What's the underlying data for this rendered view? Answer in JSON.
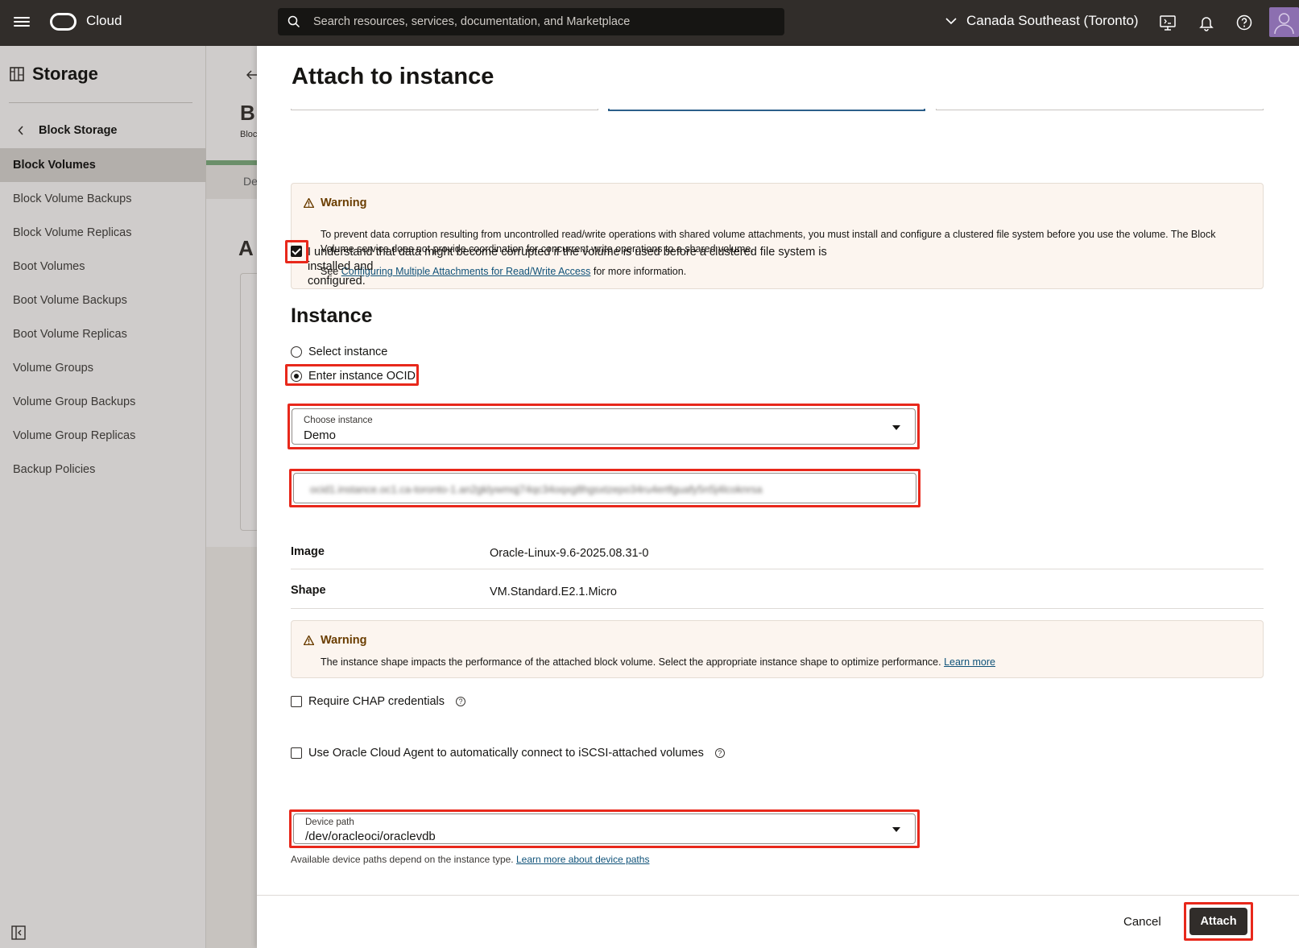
{
  "topbar": {
    "brand": "Cloud",
    "search_placeholder": "Search resources, services, documentation, and Marketplace",
    "region": "Canada Southeast (Toronto)"
  },
  "sidebar": {
    "title": "Storage",
    "back_label": "Block Storage",
    "items": [
      {
        "label": "Block Volumes",
        "active": true
      },
      {
        "label": "Block Volume Backups"
      },
      {
        "label": "Block Volume Replicas"
      },
      {
        "label": "Boot Volumes"
      },
      {
        "label": "Boot Volume Backups"
      },
      {
        "label": "Boot Volume Replicas"
      },
      {
        "label": "Volume Groups"
      },
      {
        "label": "Volume Group Backups"
      },
      {
        "label": "Volume Group Replicas"
      },
      {
        "label": "Backup Policies"
      }
    ]
  },
  "background": {
    "frag1": "B",
    "frag2": "Bloc",
    "frag3": "De",
    "frag4": "A"
  },
  "panel": {
    "title": "Attach to instance",
    "warning1": {
      "heading": "Warning",
      "text": "To prevent data corruption resulting from uncontrolled read/write operations with shared volume attachments, you must install and configure a clustered file system before you use the volume. The Block Volume service does not provide coordination for concurrent write operations to a shared volume.",
      "see_prefix": "See",
      "link": "Configuring Multiple Attachments for Read/Write Access",
      "see_suffix": "for more information."
    },
    "ack_checkbox": {
      "label_line1": "I understand that data might become corrupted if the volume is used before a clustered file system is installed and",
      "label_line2": "configured.",
      "checked": true
    },
    "instance": {
      "heading": "Instance",
      "option_select": "Select instance",
      "option_ocid": "Enter instance OCID",
      "selected": "Enter instance OCID",
      "choose_label": "Choose instance",
      "choose_value": "Demo",
      "ocid_value": "ocid1.instance.oc1.ca-toronto-1.an2gklywmqj74qc34oqxg8hgsxtzepo34ru4ertfguafy5n5j4lcoknrsa"
    },
    "details": {
      "image_label": "Image",
      "image_value": "Oracle-Linux-9.6-2025.08.31-0",
      "shape_label": "Shape",
      "shape_value": "VM.Standard.E2.1.Micro"
    },
    "warning2": {
      "heading": "Warning",
      "text": "The instance shape impacts the performance of the attached block volume. Select the appropriate instance shape to optimize performance.",
      "link": "Learn more"
    },
    "chap": {
      "label": "Require CHAP credentials",
      "checked": false
    },
    "agent": {
      "label": "Use Oracle Cloud Agent to automatically connect to iSCSI-attached volumes",
      "checked": false
    },
    "device": {
      "label": "Device path",
      "value": "/dev/oracleoci/oraclevdb",
      "help_prefix": "Available device paths depend on the instance type.",
      "help_link": "Learn more about device paths"
    },
    "footer": {
      "cancel": "Cancel",
      "attach": "Attach"
    }
  },
  "colors": {
    "topbar": "#312d2a",
    "highlight": "#e8281b",
    "warning_bg": "#fcf5ef",
    "primary_button": "#312d2a"
  }
}
